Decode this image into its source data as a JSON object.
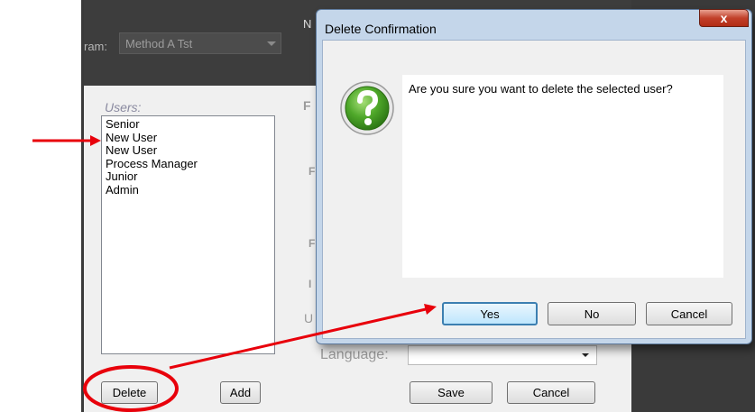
{
  "background_app": {
    "program_label_fragment": "ram:",
    "program_value": "Method A Tst",
    "header_fragment": "N",
    "users_label": "Users:",
    "users": [
      "Senior",
      "New User",
      "New User",
      "Process Manager",
      "Junior",
      "Admin"
    ],
    "partial_labels": [
      "F",
      "F",
      "F",
      "I",
      "U"
    ],
    "language_label": "Language:",
    "language_value": "",
    "buttons": {
      "delete": "Delete",
      "add": "Add",
      "save": "Save",
      "cancel": "Cancel"
    }
  },
  "dialog": {
    "title": "Delete Confirmation",
    "close_label": "x",
    "message": "Are you sure you want to delete the selected user?",
    "icon": "question-icon",
    "buttons": {
      "yes": "Yes",
      "no": "No",
      "cancel": "Cancel"
    }
  },
  "annotation": {
    "color": "#e8000b",
    "marks": [
      "arrow-to-new-user",
      "circle-around-delete",
      "arrow-to-yes"
    ]
  }
}
